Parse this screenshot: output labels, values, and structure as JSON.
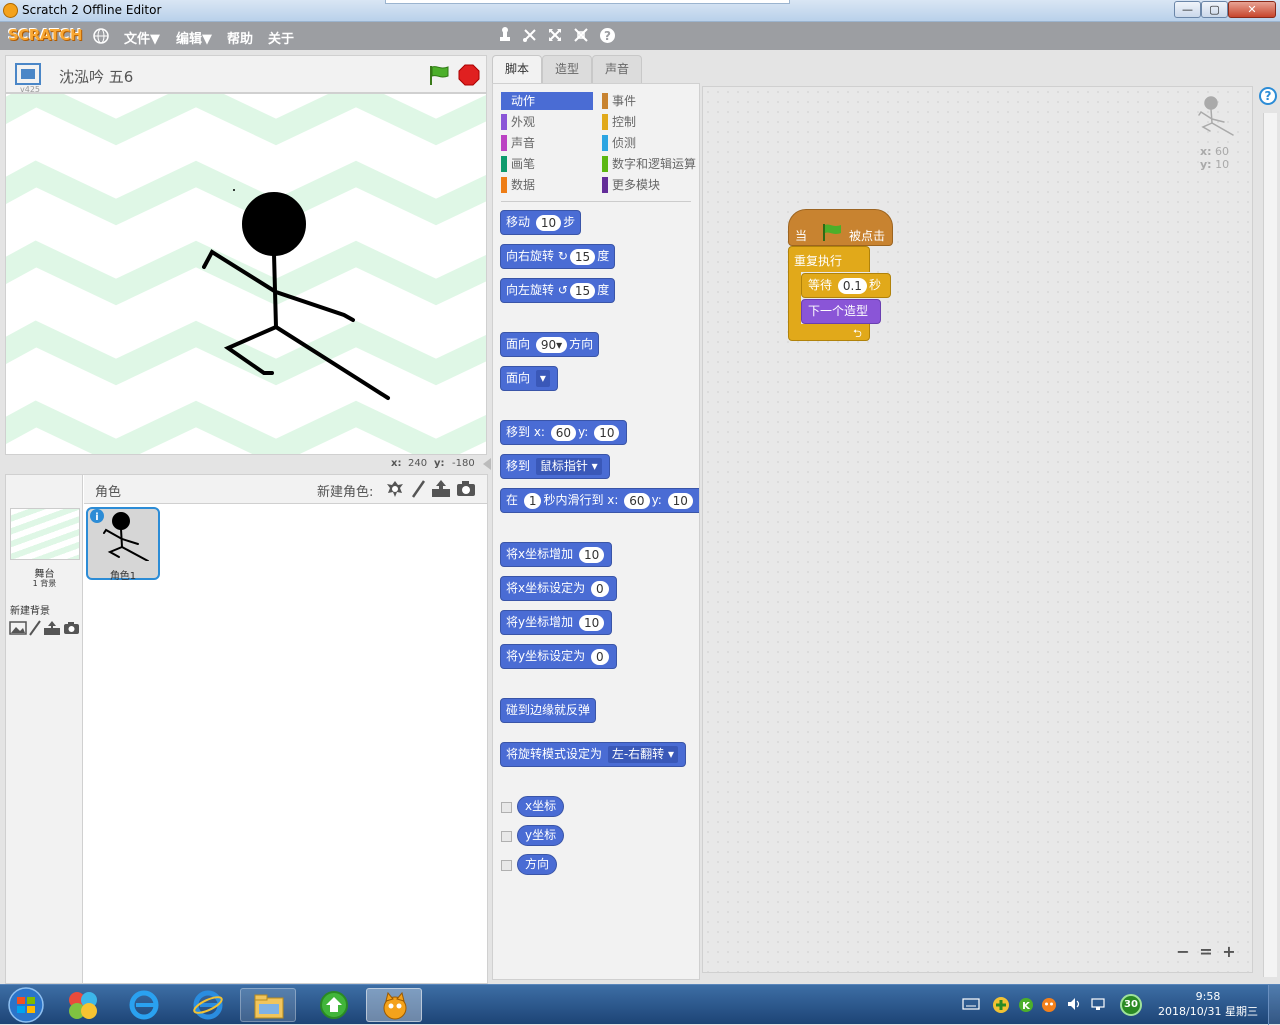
{
  "window": {
    "title": "Scratch 2 Offline Editor",
    "min": "—",
    "max": "▢",
    "close": "✕"
  },
  "menu": {
    "logo": "SCRATCH",
    "file": "文件▼",
    "edit": "编辑▼",
    "help": "帮助",
    "about": "关于"
  },
  "stage": {
    "project_name": "沈泓吟  五6",
    "version": "v425",
    "coord_x_label": "x:",
    "coord_x": "240",
    "coord_y_label": "y:",
    "coord_y": "-180"
  },
  "sprites": {
    "header": "角色",
    "new_sprite_label": "新建角色:",
    "stage_label": "舞台",
    "stage_backdrops": "1 背景",
    "new_backdrop_label": "新建背景",
    "items": [
      {
        "name": "角色1"
      }
    ]
  },
  "tabs": [
    {
      "label": "脚本"
    },
    {
      "label": "造型"
    },
    {
      "label": "声音"
    }
  ],
  "categories": [
    {
      "label": "动作",
      "color": "#4a6cd4"
    },
    {
      "label": "外观",
      "color": "#8a55d7"
    },
    {
      "label": "声音",
      "color": "#bb42c3"
    },
    {
      "label": "画笔",
      "color": "#0e9a6c"
    },
    {
      "label": "数据",
      "color": "#ee7d16"
    },
    {
      "label": "事件",
      "color": "#c88330"
    },
    {
      "label": "控制",
      "color": "#e1a91a"
    },
    {
      "label": "侦测",
      "color": "#2ca5e2"
    },
    {
      "label": "数字和逻辑运算",
      "color": "#5cb712"
    },
    {
      "label": "更多模块",
      "color": "#632d99"
    }
  ],
  "blocks": {
    "move": {
      "a": "移动",
      "v": "10",
      "b": "步"
    },
    "turn_right": {
      "a": "向右旋转",
      "v": "15",
      "b": "度"
    },
    "turn_left": {
      "a": "向左旋转",
      "v": "15",
      "b": "度"
    },
    "point_dir": {
      "a": "面向",
      "v": "90▾",
      "b": "方向"
    },
    "point_towards": {
      "a": "面向",
      "v": "▾"
    },
    "goto_xy": {
      "a": "移到 x:",
      "x": "60",
      "b": "y:",
      "y": "10"
    },
    "goto": {
      "a": "移到",
      "v": "鼠标指针 ▾"
    },
    "glide": {
      "a": "在",
      "t": "1",
      "b": "秒内滑行到 x:",
      "x": "60",
      "c": "y:",
      "y": "10"
    },
    "change_x": {
      "a": "将x坐标增加",
      "v": "10"
    },
    "set_x": {
      "a": "将x坐标设定为",
      "v": "0"
    },
    "change_y": {
      "a": "将y坐标增加",
      "v": "10"
    },
    "set_y": {
      "a": "将y坐标设定为",
      "v": "0"
    },
    "bounce": {
      "a": "碰到边缘就反弹"
    },
    "rotation_style": {
      "a": "将旋转模式设定为",
      "v": "左-右翻转 ▾"
    },
    "rep_x": "x坐标",
    "rep_y": "y坐标",
    "rep_dir": "方向"
  },
  "script": {
    "hat_a": "当",
    "hat_b": "被点击",
    "forever": "重复执行",
    "wait_a": "等待",
    "wait_v": "0.1",
    "wait_b": "秒",
    "next_costume": "下一个造型"
  },
  "sprite_info": {
    "x_label": "x:",
    "x": "60",
    "y_label": "y:",
    "y": "10"
  },
  "zoom": {
    "out": "−",
    "reset": "=",
    "in": "+"
  },
  "help_btn": "?",
  "taskbar": {
    "time": "9:58",
    "date": "2018/10/31 星期三",
    "tray_badge": "30"
  }
}
